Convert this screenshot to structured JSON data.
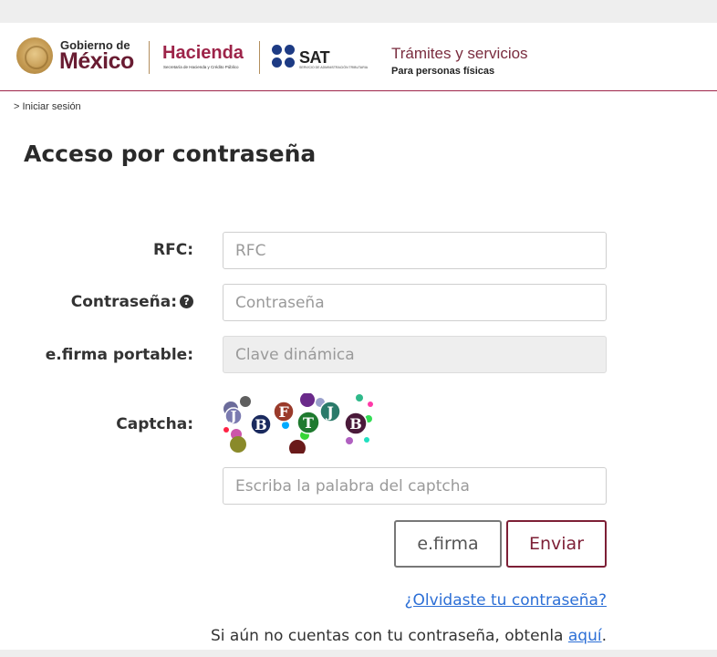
{
  "header": {
    "gob_small": "Gobierno de",
    "gob_big": "México",
    "hacienda": "Hacienda",
    "hacienda_sub": "Secretaría de Hacienda y Crédito Público",
    "sat": "SAT",
    "sat_sub": "SERVICIO DE ADMINISTRACIÓN TRIBUTARIA",
    "tramites_title": "Trámites y servicios",
    "tramites_sub": "Para personas físicas"
  },
  "breadcrumb": "> Iniciar sesión",
  "page_title": "Acceso por contraseña",
  "form": {
    "rfc_label": "RFC:",
    "rfc_placeholder": "RFC",
    "password_label": "Contraseña:",
    "password_placeholder": "Contraseña",
    "efirma_label": "e.firma portable:",
    "efirma_placeholder": "Clave dinámica",
    "captcha_label": "Captcha:",
    "captcha_letters": [
      "J",
      "B",
      "F",
      "T",
      "J",
      "B"
    ],
    "captcha_placeholder": "Escriba la palabra del captcha"
  },
  "buttons": {
    "efirma": "e.firma",
    "enviar": "Enviar"
  },
  "links": {
    "forgot": "¿Olvidaste tu contraseña?",
    "register_prefix": "Si aún no cuentas con tu contraseña, obtenla ",
    "register_link": "aquí",
    "register_suffix": "."
  },
  "colors": {
    "accent": "#9d2449",
    "link": "#2c6fd6",
    "enviar_border": "#7d1f36"
  }
}
